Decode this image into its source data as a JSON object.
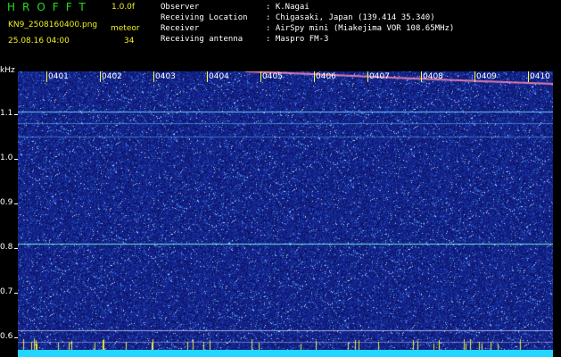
{
  "header": {
    "brand": "HROFFT",
    "version": "1.0.0f",
    "filename": "KN9_2508160400.png",
    "meteor_label": "meteor",
    "datetime": "25.08.16 04:00",
    "count": "34"
  },
  "info": [
    {
      "key": "Observer",
      "value": ": K.Nagai"
    },
    {
      "key": "Receiving Location",
      "value": ": Chigasaki, Japan (139.414 35.340)"
    },
    {
      "key": "Receiver",
      "value": ": AirSpy mini (Miakejima VOR 108.65MHz)"
    },
    {
      "key": "Receiving antenna",
      "value": ": Maspro FM-3"
    }
  ],
  "axis": {
    "unit": "kHz",
    "y_ticks": [
      "1.1",
      "1.0",
      "0.9",
      "0.8",
      "0.7",
      "0.6"
    ],
    "time_ticks": [
      "0401",
      "0402",
      "0403",
      "0404",
      "0405",
      "0406",
      "0407",
      "0408",
      "0409",
      "0410"
    ]
  },
  "colors": {
    "background": "#000000",
    "plot": "#1a2a8c",
    "brand": "#22dd22",
    "meta": "#eeee22",
    "bottom_band": "#22d6ff"
  }
}
